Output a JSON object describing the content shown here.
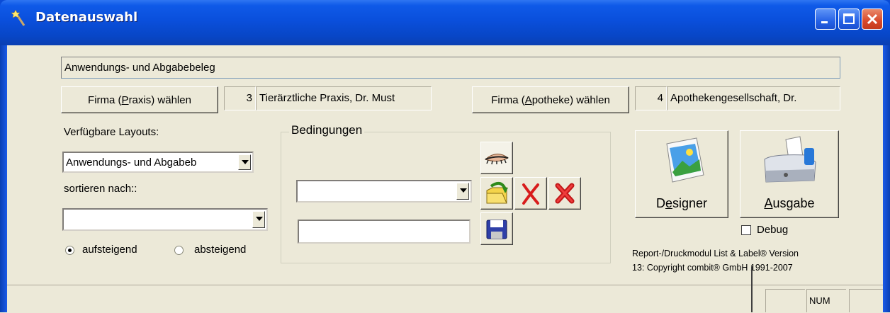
{
  "window": {
    "title": "Datenauswahl"
  },
  "report_name": "Anwendungs- und Abgabebeleg",
  "firma_praxis": {
    "button_label_pre": "Firma (",
    "button_label_key": "P",
    "button_label_post": "raxis) wählen",
    "id": "3",
    "name": "Tierärztliche Praxis, Dr. Must"
  },
  "firma_apotheke": {
    "button_label_pre": "Firma (",
    "button_label_key": "A",
    "button_label_post": "potheke) wählen",
    "id": "4",
    "name": "Apothekengesellschaft, Dr."
  },
  "layouts": {
    "label": "Verfügbare Layouts:",
    "selected": "Anwendungs- und Abgabeb"
  },
  "sort": {
    "label": "sortieren nach::",
    "selected": "",
    "asc_label": "aufsteigend",
    "desc_label": "absteigend",
    "ascending": true
  },
  "conditions": {
    "group_label": "Bedingungen",
    "combo_value": "",
    "text_value": ""
  },
  "designer": {
    "label_pre": "D",
    "label_key": "e",
    "label_post": "signer"
  },
  "ausgabe": {
    "label_pre": "",
    "label_key": "A",
    "label_post": "usgabe"
  },
  "debug": {
    "label": "Debug",
    "checked": false
  },
  "version_text": {
    "line1": "Report-/Druckmodul List & Label® Version",
    "line2": "13: Copyright combit® GmbH 1991-2007"
  },
  "status": {
    "num": "NUM"
  }
}
